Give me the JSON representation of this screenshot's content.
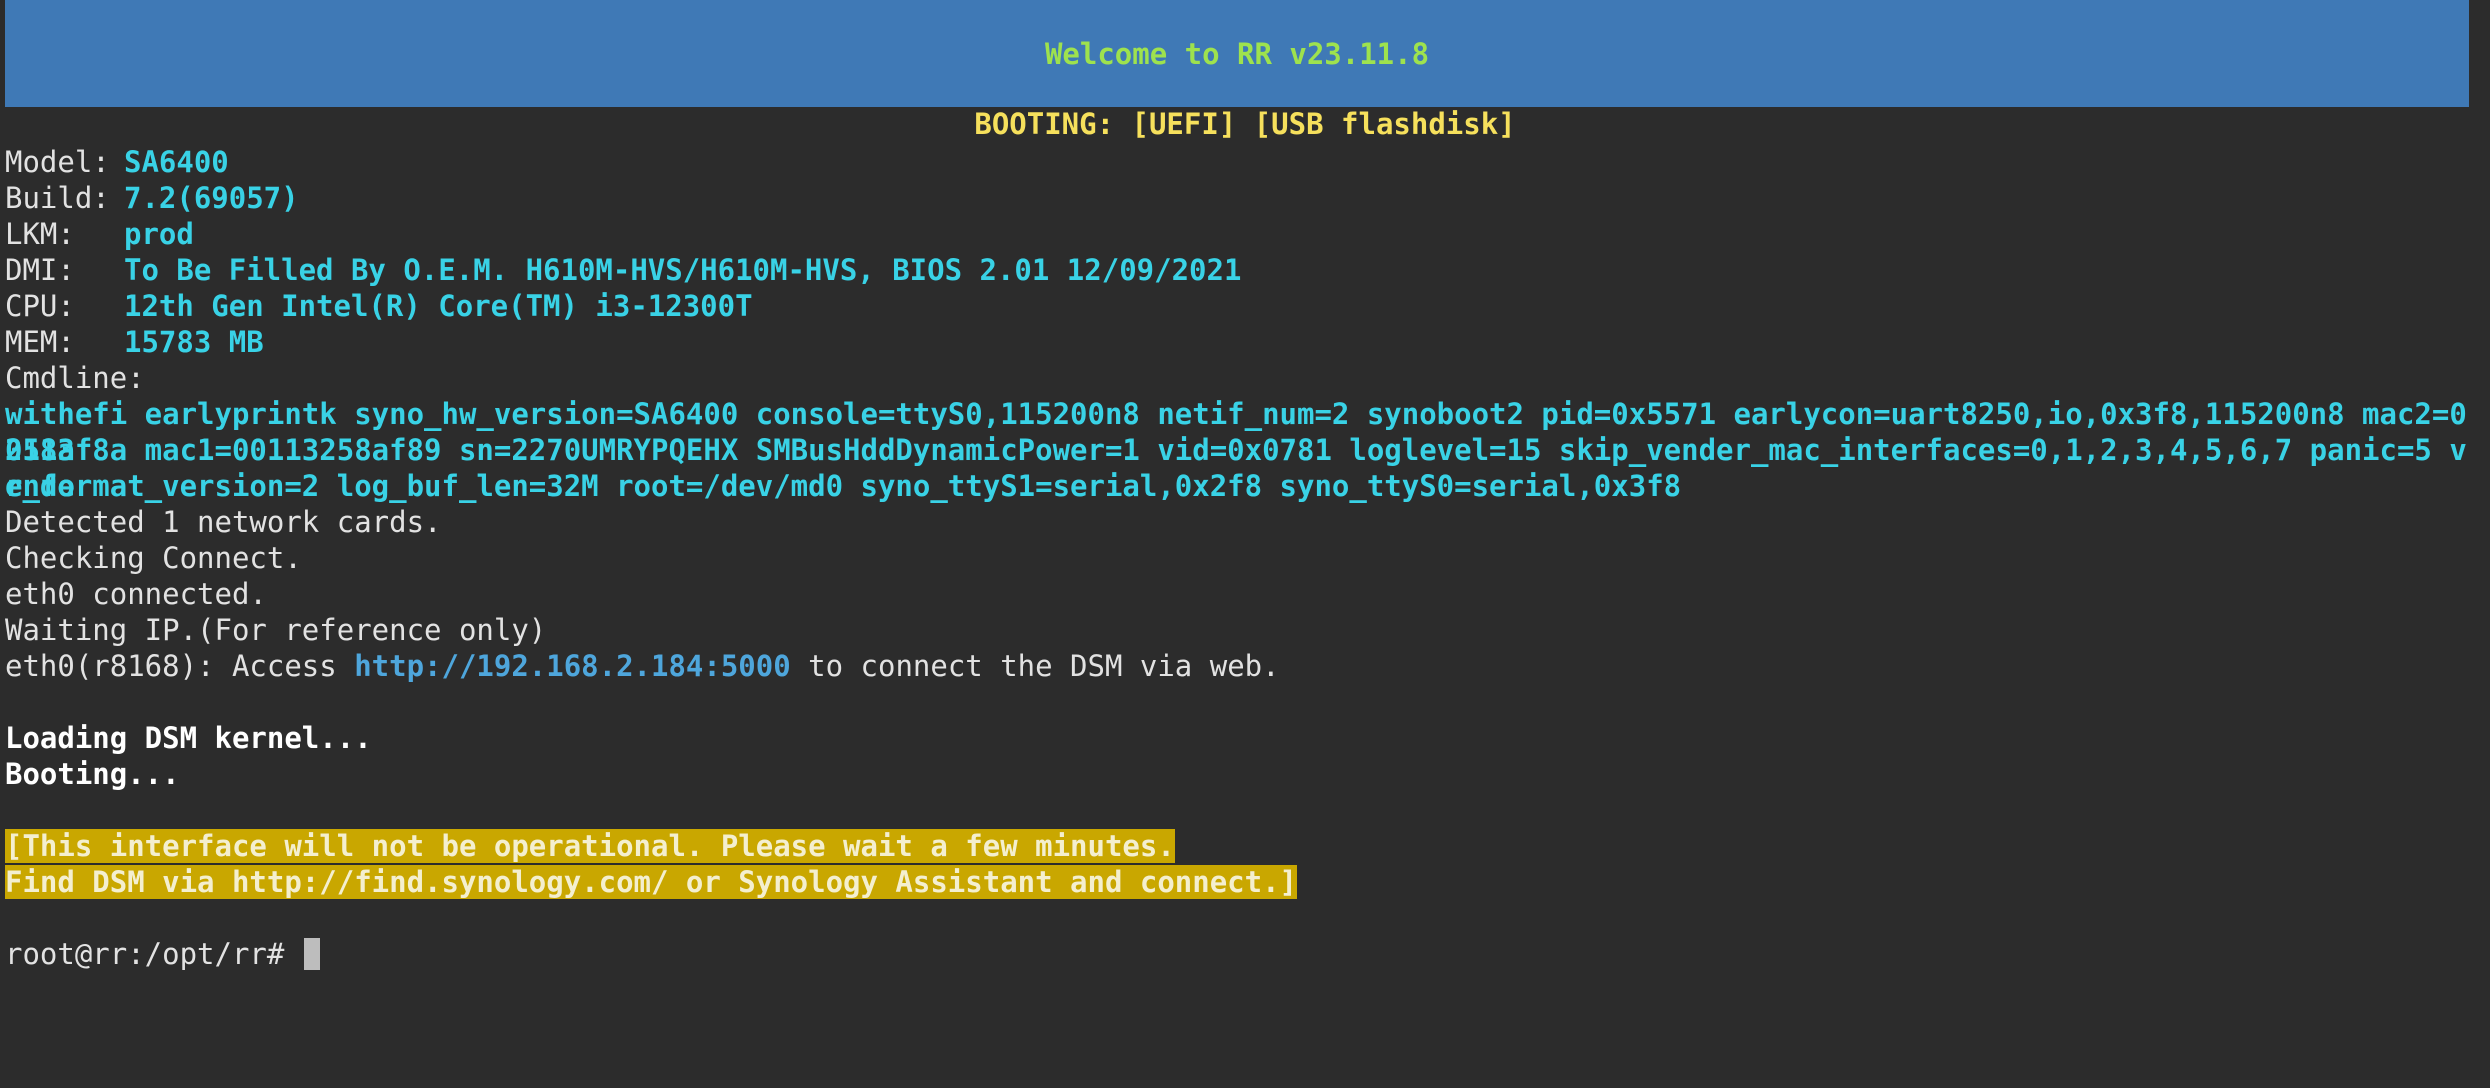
{
  "banner": {
    "title": "Welcome to RR v23.11.8"
  },
  "boot_line": "BOOTING: [UEFI] [USB flashdisk]",
  "info": [
    {
      "label": "Model:",
      "value": "SA6400"
    },
    {
      "label": "Build:",
      "value": "7.2(69057)"
    },
    {
      "label": "LKM:",
      "value": "prod"
    },
    {
      "label": "DMI:",
      "value": "To Be Filled By O.E.M. H610M-HVS/H610M-HVS, BIOS 2.01 12/09/2021"
    },
    {
      "label": "CPU:",
      "value": "12th Gen Intel(R) Core(TM) i3-12300T"
    },
    {
      "label": "MEM:",
      "value": "15783 MB"
    }
  ],
  "cmdline_label": "Cmdline:",
  "cmdline_lines": [
    "withefi earlyprintk syno_hw_version=SA6400 console=ttyS0,115200n8 netif_num=2 synoboot2 pid=0x5571 earlycon=uart8250,io,0x3f8,115200n8 mac2=00113",
    "258af8a mac1=00113258af89 sn=2270UMRYPQEHX SMBusHddDynamicPower=1 vid=0x0781 loglevel=15 skip_vender_mac_interfaces=0,1,2,3,4,5,6,7 panic=5 vende",
    "r_format_version=2 log_buf_len=32M root=/dev/md0 syno_ttyS1=serial,0x2f8 syno_ttyS0=serial,0x3f8"
  ],
  "status": {
    "network_cards": "Detected 1 network cards.",
    "checking": "Checking Connect.",
    "connected": "eth0 connected.",
    "waiting_ip": "Waiting IP.(For reference only)",
    "access_prefix": "eth0(r8168): Access ",
    "access_url": "http://192.168.2.184:5000",
    "access_suffix": " to connect the DSM via web."
  },
  "loading": "Loading DSM kernel...",
  "booting": "Booting...",
  "notice": {
    "line1": "[This interface will not be operational. Please wait a few minutes.",
    "line2": "Find DSM via http://find.synology.com/ or Synology Assistant and connect.]"
  },
  "prompt": "root@rr:/opt/rr# ",
  "colors": {
    "background": "#2c2c2c",
    "banner": "#3f79b6",
    "banner_text": "#9ee24e",
    "boot_text": "#f6e05c",
    "value_text": "#39d2e6",
    "link": "#4ea6dc",
    "highlight": "#c9a700"
  }
}
